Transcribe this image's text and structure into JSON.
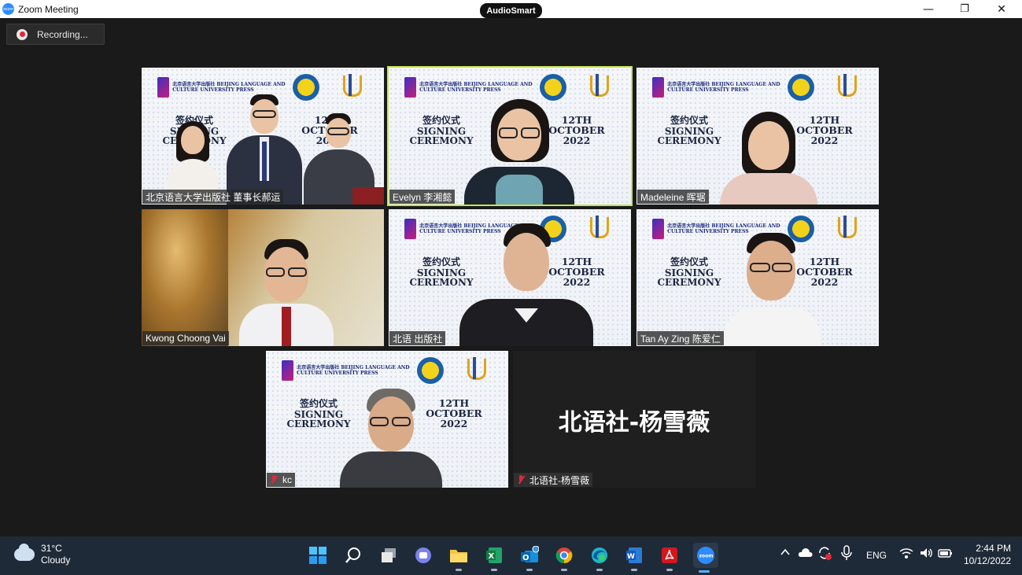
{
  "window": {
    "title": "Zoom Meeting",
    "center_badge": "AudioSmart",
    "minimize_symbol": "—",
    "restore_symbol": "❐",
    "close_symbol": "✕"
  },
  "recording": {
    "label": "Recording..."
  },
  "ceremony": {
    "publisher_logo_text": "北京语言大学出版社 BEIJING LANGUAGE AND CULTURE UNIVERSITY PRESS",
    "signing_cn": "签约仪式",
    "signing_en_1": "SIGNING",
    "signing_en_2": "CEREMONY",
    "date_1": "12TH",
    "date_2": "OCTOBER",
    "date_3": "2022"
  },
  "participants": [
    {
      "name": "北京语言大学出版社 董事长郝运",
      "muted": false,
      "speaking": false
    },
    {
      "name": "Evelyn 李湘懿",
      "muted": false,
      "speaking": true
    },
    {
      "name": "Madeleine 晖琚",
      "muted": false,
      "speaking": false
    },
    {
      "name": "Kwong Choong Vai",
      "muted": false,
      "speaking": false
    },
    {
      "name": "北语 出版社",
      "muted": false,
      "speaking": false
    },
    {
      "name": "Tan Ay Zing 陈爱仁",
      "muted": false,
      "speaking": false
    },
    {
      "name": "kc",
      "muted": true,
      "speaking": false
    },
    {
      "name": "北语社-杨雪薇",
      "muted": true,
      "speaking": false,
      "audio_only_display": "北语社-杨雪薇"
    }
  ],
  "taskbar": {
    "weather_temp": "31°C",
    "weather_desc": "Cloudy",
    "apps": [
      "windows-start",
      "search",
      "task-view",
      "teams-chat",
      "file-explorer",
      "excel",
      "outlook",
      "chrome",
      "edge",
      "word",
      "acrobat",
      "zoom"
    ],
    "language": "ENG",
    "time": "2:44 PM",
    "date": "10/12/2022"
  }
}
